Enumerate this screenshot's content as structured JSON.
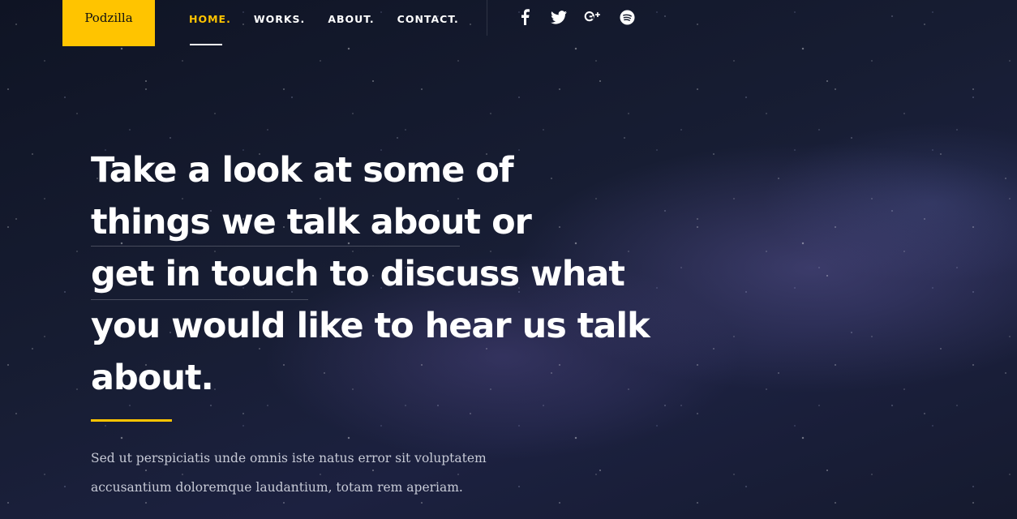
{
  "brand": {
    "name": "Podzilla",
    "color": "#ffc400"
  },
  "nav": {
    "items": [
      {
        "label": "HOME.",
        "active": true
      },
      {
        "label": "WORKS.",
        "active": false
      },
      {
        "label": "ABOUT.",
        "active": false
      },
      {
        "label": "CONTACT.",
        "active": false
      }
    ]
  },
  "social": [
    {
      "icon": "facebook-icon"
    },
    {
      "icon": "twitter-icon"
    },
    {
      "icon": "google-plus-icon"
    },
    {
      "icon": "spotify-icon"
    }
  ],
  "hero": {
    "headline_lines": [
      "Take a look at some of",
      "things we talk about or",
      "get in touch to discuss what",
      "you would like to hear us talk",
      "about."
    ],
    "lead_lines": [
      "Sed ut perspiciatis unde omnis iste natus error sit voluptatem",
      "accusantium doloremque laudantium, totam rem aperiam."
    ]
  }
}
